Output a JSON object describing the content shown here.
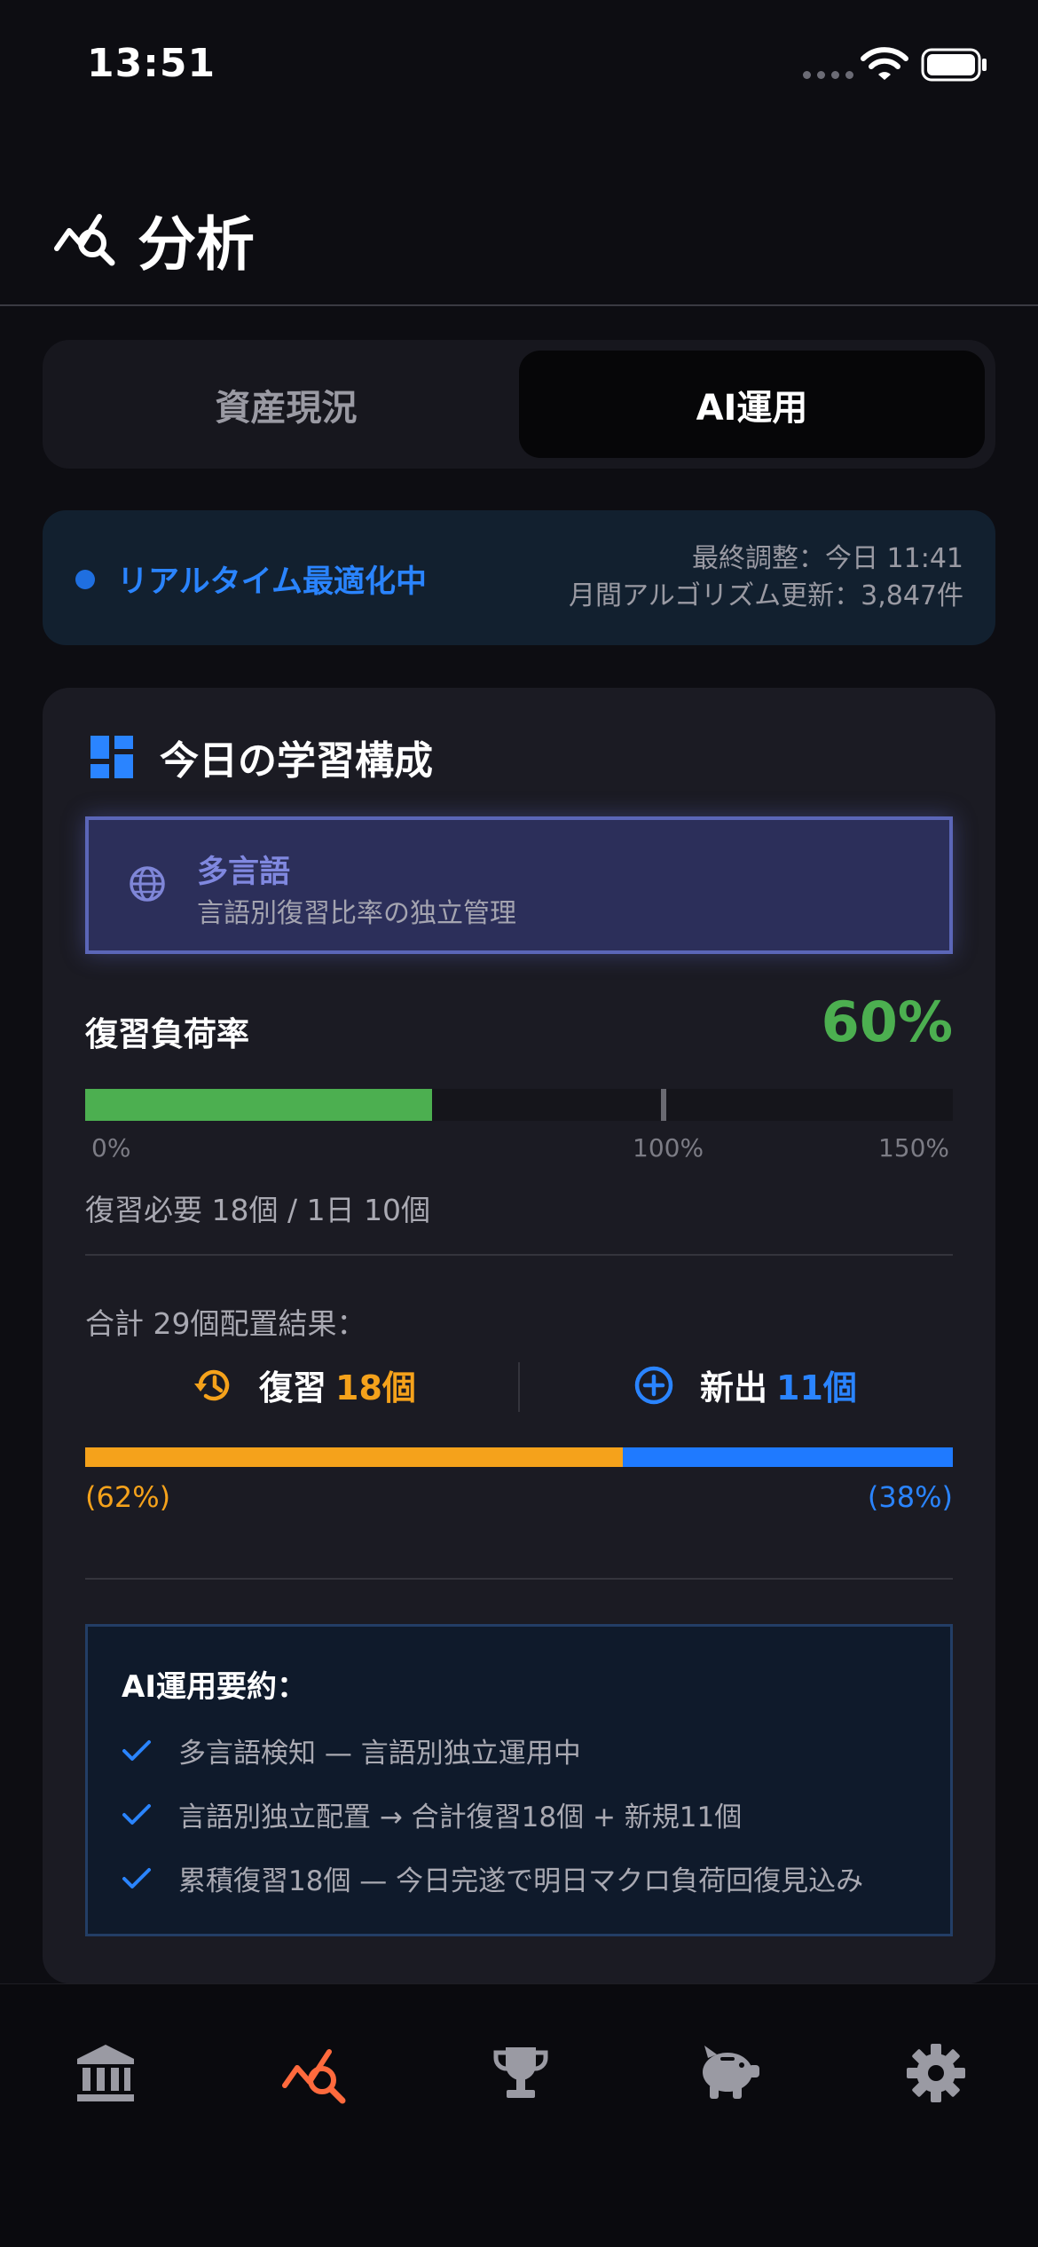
{
  "status_bar": {
    "time": "13:51"
  },
  "header": {
    "title": "分析",
    "icon": "analytics-icon"
  },
  "segmented": {
    "tabs": [
      "資産現況",
      "AI運用"
    ],
    "active_index": 1
  },
  "realtime": {
    "label": "リアルタイム最適化中",
    "last_adjust": "最終調整：今日 11:41",
    "monthly_updates": "月間アルゴリズム更新：3,847件"
  },
  "card": {
    "title": "今日の学習構成",
    "language": {
      "title": "多言語",
      "subtitle": "言語別復習比率の独立管理"
    },
    "load": {
      "label": "復習負荷率",
      "value_text": "60%",
      "fill_percent": 60,
      "max_percent": 150,
      "marker_percent": 100,
      "axis": [
        "0%",
        "100%",
        "150%"
      ],
      "detail": "復習必要 18個 / 1日 10個"
    },
    "allocation": {
      "title": "合計 29個配置結果：",
      "review_label": "復習",
      "review_count": "18個",
      "new_label": "新出",
      "new_count": "11個",
      "review_fraction": 0.62,
      "review_pct": "(62%)",
      "new_pct": "(38%)"
    },
    "summary": {
      "title": "AI運用要約：",
      "items": [
        "多言語検知 — 言語別独立運用中",
        "言語別独立配置 → 合計復習18個 + 新規11個",
        "累積復習18個 — 今日完遂で明日マクロ負荷回復見込み"
      ]
    }
  },
  "tab_bar": {
    "items": [
      "bank-icon",
      "analytics-icon",
      "trophy-icon",
      "piggy-bank-icon",
      "gear-icon"
    ],
    "active_index": 1
  },
  "colors": {
    "accent_blue": "#2a84ff",
    "green": "#4caf50",
    "orange": "#f5a21b",
    "active_tab": "#ff6a3d"
  }
}
